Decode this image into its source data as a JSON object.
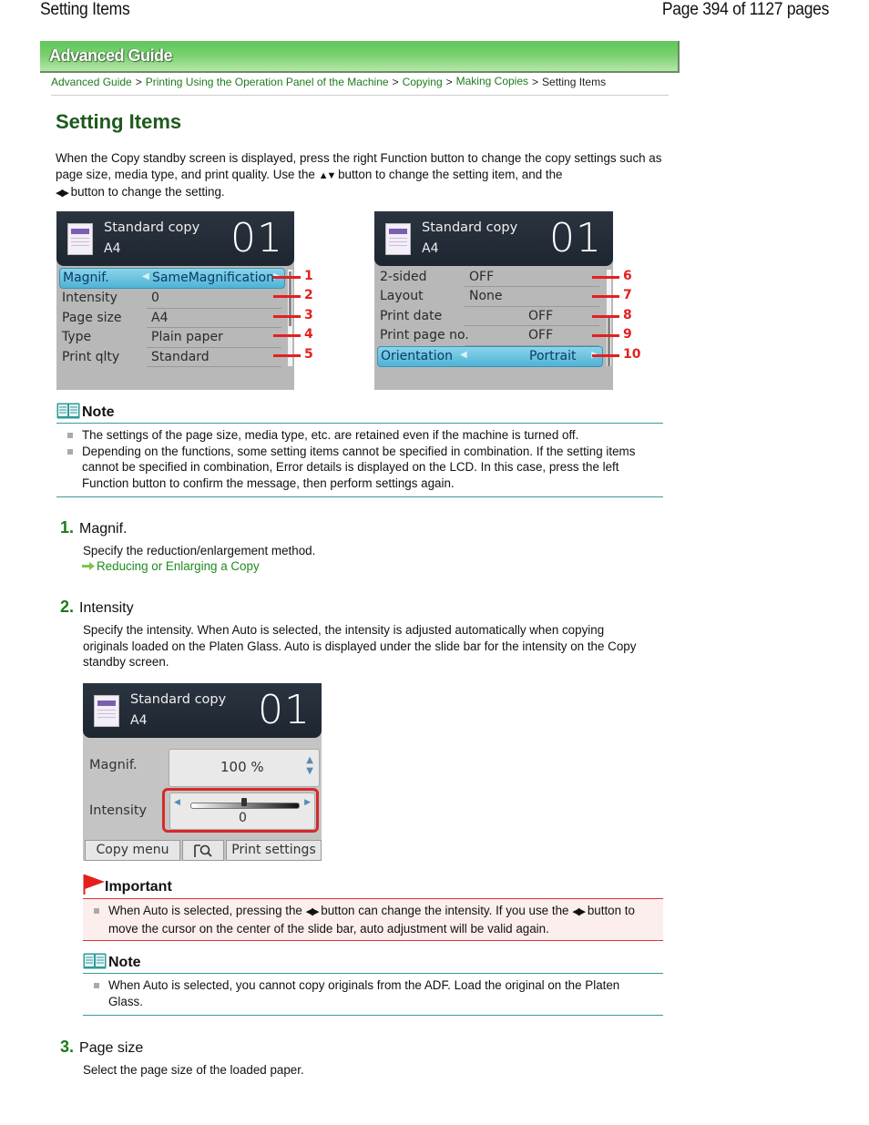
{
  "page_header": {
    "title": "Setting Items",
    "page_info": "Page 394 of 1127 pages"
  },
  "banner": {
    "label": "Advanced Guide"
  },
  "breadcrumb": [
    {
      "label": "Advanced Guide",
      "link": true
    },
    {
      "label": "Printing Using the Operation Panel of the Machine",
      "link": true
    },
    {
      "label": "Copying",
      "link": true
    },
    {
      "label": "Making Copies",
      "link": true
    },
    {
      "label": "Setting Items",
      "link": false
    }
  ],
  "breadcrumb_sep": ">",
  "heading": "Setting Items",
  "intro": {
    "part1": "When the Copy standby screen is displayed, press the right Function button to change the copy settings such as page size, media type, and print quality. Use the ",
    "updown_glyph": "▲▼",
    "part2": " button to change the setting item, and the ",
    "leftright_glyph": "◀▶",
    "part3": " button to change the setting."
  },
  "lcd_common": {
    "title": "Standard copy",
    "size": "A4",
    "count": "01"
  },
  "lcd1": {
    "rows": [
      {
        "label": "Magnif.",
        "value": "SameMagnification",
        "selected": true,
        "callout": "1"
      },
      {
        "label": "Intensity",
        "value": "0",
        "callout": "2"
      },
      {
        "label": "Page size",
        "value": "A4",
        "callout": "3"
      },
      {
        "label": "Type",
        "value": "Plain paper",
        "callout": "4"
      },
      {
        "label": "Print qlty",
        "value": "Standard",
        "callout": "5"
      }
    ]
  },
  "lcd2": {
    "rows": [
      {
        "label": "2-sided",
        "value": "OFF",
        "callout": "6"
      },
      {
        "label": "Layout",
        "value": "None",
        "callout": "7"
      },
      {
        "label": "Print date",
        "value": "OFF",
        "callout": "8"
      },
      {
        "label": "Print page no.",
        "value": "OFF",
        "callout": "9"
      },
      {
        "label": "Orientation",
        "value": "Portrait",
        "selected": true,
        "callout": "10"
      }
    ]
  },
  "note1": {
    "title": "Note",
    "items": [
      "The settings of the page size, media type, etc. are retained even if the machine is turned off.",
      "Depending on the functions, some setting items cannot be specified in combination. If the setting items cannot be specified in combination, Error details is displayed on the LCD. In this case, press the left Function button to confirm the message, then perform settings again."
    ]
  },
  "steps": [
    {
      "num": "1.",
      "title": "Magnif.",
      "body": "Specify the reduction/enlargement method.",
      "link": "Reducing or Enlarging a Copy"
    },
    {
      "num": "2.",
      "title": "Intensity",
      "body": "Specify the intensity. When Auto is selected, the intensity is adjusted automatically when copying originals loaded on the Platen Glass. Auto is displayed under the slide bar for the intensity on the Copy standby screen."
    },
    {
      "num": "3.",
      "title": "Page size",
      "body": "Select the page size of the loaded paper."
    }
  ],
  "lcd3": {
    "magnif_label": "Magnif.",
    "magnif_value": "100 %",
    "intensity_label": "Intensity",
    "intensity_value": "0",
    "intensity_position": 0.5,
    "buttons": {
      "left": "Copy menu",
      "right": "Print settings"
    }
  },
  "important": {
    "title": "Important",
    "text_a": "When Auto is selected, pressing the ",
    "glyph": "◀▶",
    "text_b": " button can change the intensity. If you use the ",
    "text_c": " button to move the cursor on the center of the slide bar, auto adjustment will be valid again."
  },
  "note2": {
    "title": "Note",
    "items": [
      "When Auto is selected, you cannot copy originals from the ADF. Load the original on the Platen Glass."
    ]
  },
  "colors": {
    "heading_green": "#1e5a1e",
    "link_green": "#1f7a1f",
    "callout_red": "#e42020",
    "note_teal": "#3a9a9a",
    "important_red": "#d33"
  }
}
